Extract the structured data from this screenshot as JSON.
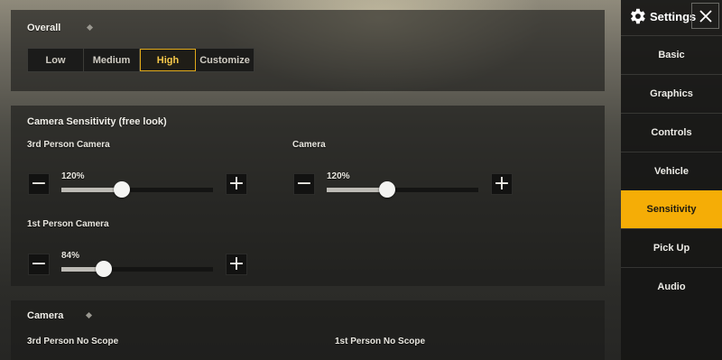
{
  "header": {
    "title": "Settings",
    "icon": "gear-icon",
    "close_icon": "close-icon"
  },
  "sidebar": {
    "active": "Sensitivity",
    "active_color": "#f5ad06",
    "items": [
      {
        "label": "Basic"
      },
      {
        "label": "Graphics"
      },
      {
        "label": "Controls"
      },
      {
        "label": "Vehicle"
      },
      {
        "label": "Sensitivity"
      },
      {
        "label": "Pick Up"
      },
      {
        "label": "Audio"
      }
    ]
  },
  "overall": {
    "title": "Overall",
    "selected": "High",
    "options": [
      "Low",
      "Medium",
      "High",
      "Customize"
    ]
  },
  "camera_sensitivity": {
    "title": "Camera Sensitivity (free look)",
    "third_person": {
      "label": "3rd Person Camera",
      "value": "120%",
      "level": 0.4
    },
    "camera": {
      "label": "Camera",
      "value": "120%",
      "level": 0.4
    },
    "first_person": {
      "label": "1st Person Camera",
      "value": "84%",
      "level": 0.28
    },
    "decrease_symbol": "−",
    "increase_symbol": "+"
  },
  "camera_section": {
    "title": "Camera",
    "third_person_no_scope": "3rd Person No Scope",
    "first_person_no_scope": "1st Person No Scope"
  }
}
